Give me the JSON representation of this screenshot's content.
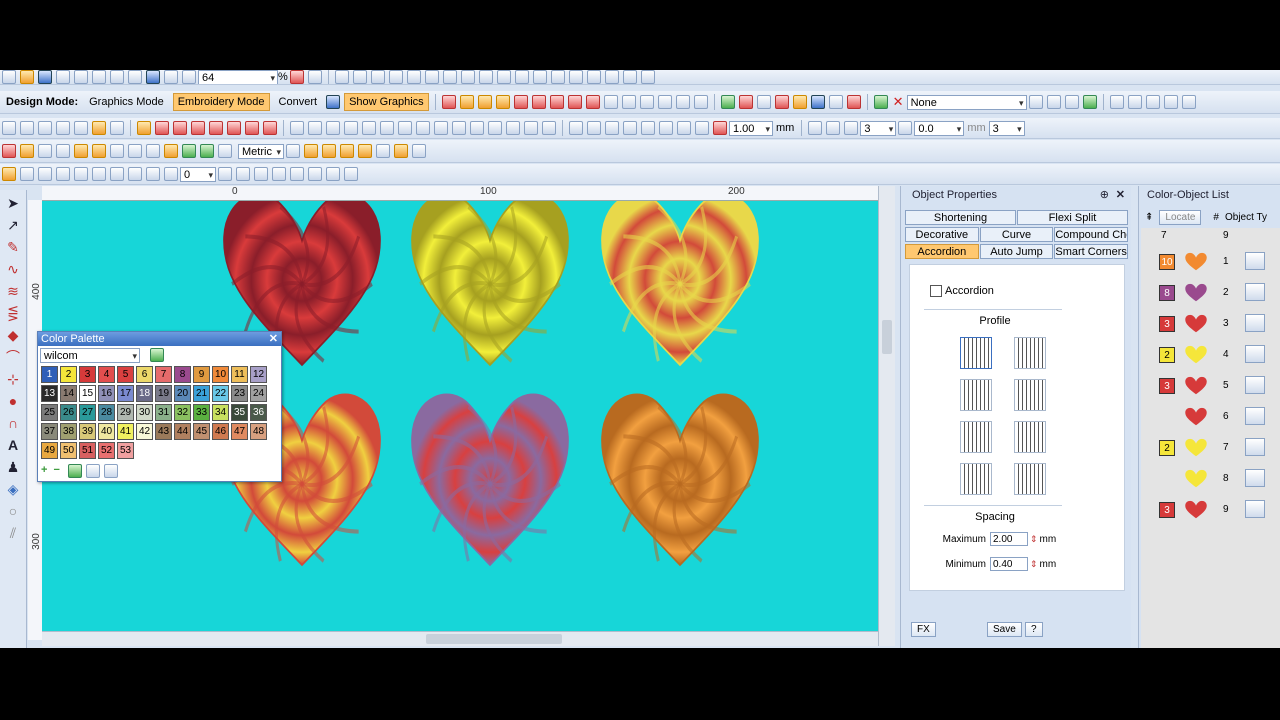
{
  "toolbar1": {
    "zoom": "64",
    "percent": "%"
  },
  "toolbar2": {
    "design_mode_label": "Design Mode:",
    "graphics_mode": "Graphics Mode",
    "embroidery_mode": "Embroidery Mode",
    "convert": "Convert",
    "show_graphics": "Show Graphics",
    "none_combo": "None"
  },
  "toolbar3": {
    "value": "1.00",
    "unit": "mm",
    "count1": "3",
    "value2": "0.0",
    "unit2": "mm",
    "count2": "3"
  },
  "toolbar4": {
    "units": "Metric"
  },
  "toolbar5": {
    "value": "0"
  },
  "ruler": {
    "h_ticks": [
      "0",
      "100",
      "200"
    ],
    "v_ticks": [
      "400",
      "300"
    ]
  },
  "colors": {
    "canvas": "#17d6d8",
    "active_tab": "#ffc870",
    "panel": "#d6e2f2"
  },
  "hearts": [
    {
      "name": "heart-red-spiral",
      "fill1": "#d93b3b",
      "fill2": "#8a1e2a"
    },
    {
      "name": "heart-yellow-spiral",
      "fill1": "#f2ef3a",
      "fill2": "#a6a020"
    },
    {
      "name": "heart-red-yellow-radial",
      "fill1": "#d24a3a",
      "fill2": "#e8d84a"
    },
    {
      "name": "heart-yellow-red-radial",
      "fill1": "#f0d040",
      "fill2": "#d24a3a"
    },
    {
      "name": "heart-red-purple-radial",
      "fill1": "#d84040",
      "fill2": "#8a6aa0"
    },
    {
      "name": "heart-orange-spiral",
      "fill1": "#f2a040",
      "fill2": "#b86a20"
    }
  ],
  "color_palette": {
    "title": "Color Palette",
    "close": "✕",
    "selected": "wilcom",
    "swatches": [
      {
        "n": "1",
        "c": "#2f5fb8"
      },
      {
        "n": "2",
        "c": "#f5e63a"
      },
      {
        "n": "3",
        "c": "#d63a3a"
      },
      {
        "n": "4",
        "c": "#e24e4e"
      },
      {
        "n": "5",
        "c": "#d94040"
      },
      {
        "n": "6",
        "c": "#ecd86a"
      },
      {
        "n": "7",
        "c": "#e66b6b"
      },
      {
        "n": "8",
        "c": "#9a4a8e"
      },
      {
        "n": "9",
        "c": "#e09a40"
      },
      {
        "n": "10",
        "c": "#f08a3a"
      },
      {
        "n": "11",
        "c": "#eebe5a"
      },
      {
        "n": "12",
        "c": "#a8a0c8"
      },
      {
        "n": "13",
        "c": "#2a2a2a"
      },
      {
        "n": "14",
        "c": "#8a7a70"
      },
      {
        "n": "15",
        "c": "#ffffff"
      },
      {
        "n": "16",
        "c": "#9090b8"
      },
      {
        "n": "17",
        "c": "#7a8ad0"
      },
      {
        "n": "18",
        "c": "#6a6a88"
      },
      {
        "n": "19",
        "c": "#7a7a8a"
      },
      {
        "n": "20",
        "c": "#5a88b8"
      },
      {
        "n": "21",
        "c": "#3aa0d8"
      },
      {
        "n": "22",
        "c": "#6ac8e8"
      },
      {
        "n": "23",
        "c": "#8a8a8a"
      },
      {
        "n": "24",
        "c": "#a0a0a0"
      },
      {
        "n": "25",
        "c": "#7a7a7a"
      },
      {
        "n": "26",
        "c": "#3a8a8a"
      },
      {
        "n": "27",
        "c": "#2a9a9a"
      },
      {
        "n": "28",
        "c": "#4a8aa0"
      },
      {
        "n": "29",
        "c": "#b0b8b0"
      },
      {
        "n": "30",
        "c": "#d0d8c8"
      },
      {
        "n": "31",
        "c": "#8ab08a"
      },
      {
        "n": "32",
        "c": "#8ac060"
      },
      {
        "n": "33",
        "c": "#5ab040"
      },
      {
        "n": "34",
        "c": "#c8e060"
      },
      {
        "n": "35",
        "c": "#3a4a3a"
      },
      {
        "n": "36",
        "c": "#4a5a4a"
      },
      {
        "n": "37",
        "c": "#8a8a7a"
      },
      {
        "n": "38",
        "c": "#a0a070"
      },
      {
        "n": "39",
        "c": "#d8c878"
      },
      {
        "n": "40",
        "c": "#f0e8a0"
      },
      {
        "n": "41",
        "c": "#f0f060"
      },
      {
        "n": "42",
        "c": "#f8f8d8"
      },
      {
        "n": "43",
        "c": "#9a7a5a"
      },
      {
        "n": "44",
        "c": "#b08060"
      },
      {
        "n": "45",
        "c": "#c09070"
      },
      {
        "n": "46",
        "c": "#d07a50"
      },
      {
        "n": "47",
        "c": "#e08a60"
      },
      {
        "n": "48",
        "c": "#d8a080"
      },
      {
        "n": "49",
        "c": "#e8a840"
      },
      {
        "n": "50",
        "c": "#f0c070"
      },
      {
        "n": "51",
        "c": "#d86060"
      },
      {
        "n": "52",
        "c": "#e87070"
      },
      {
        "n": "53",
        "c": "#f0a0a0"
      }
    ]
  },
  "object_properties": {
    "title": "Object Properties",
    "pin": "⊕",
    "close": "✕",
    "tabs_row1": [
      "Shortening",
      "Flexi Split"
    ],
    "tabs_row2": [
      "Decorative",
      "Curve",
      "Compound Che..."
    ],
    "tabs_row3": [
      "Accordion",
      "Auto Jump",
      "Smart Corners"
    ],
    "accordion_label": "Accordion",
    "profile_label": "Profile",
    "spacing_label": "Spacing",
    "maximum_label": "Maximum",
    "maximum_value": "2.00",
    "minimum_label": "Minimum",
    "minimum_value": "0.40",
    "unit": "mm",
    "fx": "FX",
    "save": "Save",
    "help": "?"
  },
  "color_object_list": {
    "title": "Color-Object List",
    "locate": "Locate",
    "hash": "#",
    "object_type": "Object Ty",
    "col_a": "7",
    "col_b": "9",
    "rows": [
      {
        "color_num": "10",
        "color": "#f28a30",
        "idx": "1"
      },
      {
        "color_num": "8",
        "color": "#9a4a8e",
        "idx": "2"
      },
      {
        "color_num": "3",
        "color": "#d63a3a",
        "idx": "3"
      },
      {
        "color_num": "2",
        "color": "#f5e63a",
        "idx": "4"
      },
      {
        "color_num": "3",
        "color": "#d63a3a",
        "idx": "5"
      },
      {
        "color_num": "",
        "color": "#d63a3a",
        "idx": "6"
      },
      {
        "color_num": "2",
        "color": "#f5e63a",
        "idx": "7"
      },
      {
        "color_num": "",
        "color": "#f5e63a",
        "idx": "8"
      },
      {
        "color_num": "3",
        "color": "#d63a3a",
        "idx": "9"
      }
    ]
  }
}
